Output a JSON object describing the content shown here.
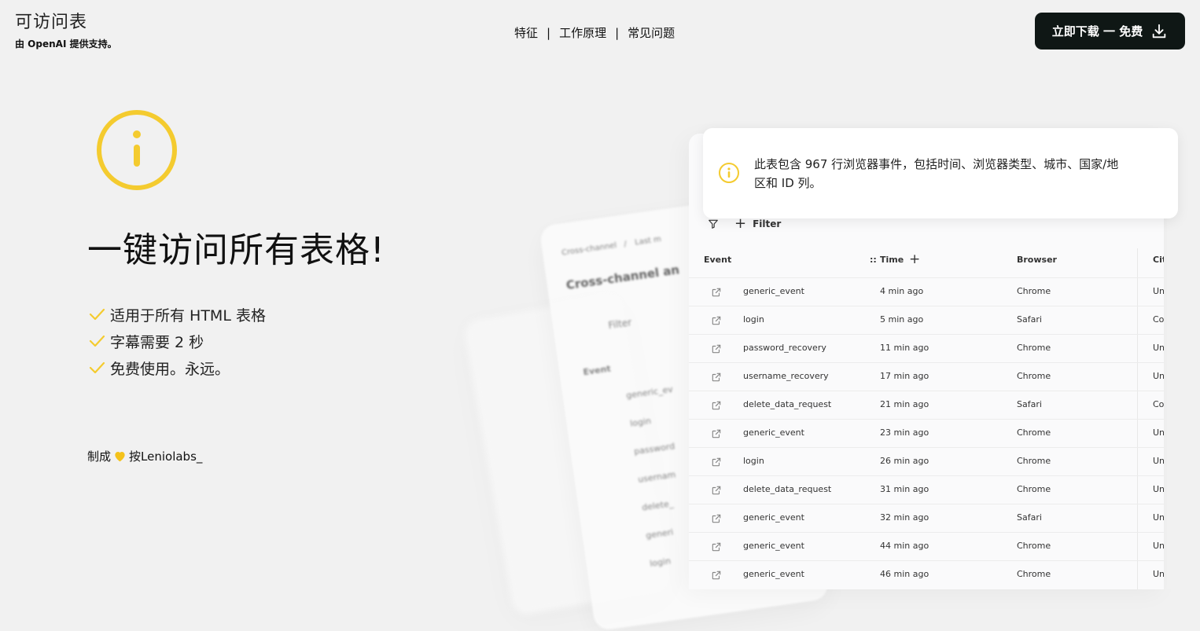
{
  "header": {
    "brand_title": "可访问表",
    "brand_sub": "由 OpenAI 提供支持。",
    "nav": [
      "特征",
      "工作原理",
      "常见问题"
    ],
    "nav_separator": "|",
    "download_label": "立即下载 一 免费"
  },
  "hero": {
    "title": "一键访问所有表格!",
    "features": [
      "适用于所有 HTML 表格",
      "字幕需要 2 秒",
      "免费使用。永远。"
    ],
    "made_prefix": "制成",
    "made_suffix": "按Leniolabs_"
  },
  "colors": {
    "accent_yellow": "#f4cb2f",
    "button_bg": "#0f1715",
    "heart": "#f4c21b"
  },
  "tooltip": {
    "text": "此表包含 967 行浏览器事件，包括时间、浏览器类型、城市、国家/地区和 ID 列。",
    "icon": "info-icon"
  },
  "back_card": {
    "breadcrumb_1": "Cross-channel",
    "breadcrumb_sep": "/",
    "breadcrumb_2": "Last m",
    "title": "Cross-channel an",
    "filter": "Filter",
    "event": "Event",
    "rows": [
      "generic_ev",
      "login",
      "password",
      "usernam",
      "delete_",
      "generi",
      "login"
    ]
  },
  "table": {
    "filter_label": "Filter",
    "time_prefix": "::",
    "columns": [
      "Event",
      "Time",
      "Browser",
      "Cit"
    ],
    "rows": [
      {
        "event": "generic_event",
        "time": "4 min ago",
        "browser": "Chrome",
        "city": "Un"
      },
      {
        "event": "login",
        "time": "5 min ago",
        "browser": "Safari",
        "city": "Co"
      },
      {
        "event": "password_recovery",
        "time": "11 min ago",
        "browser": "Chrome",
        "city": "Un"
      },
      {
        "event": "username_recovery",
        "time": "17 min ago",
        "browser": "Chrome",
        "city": "Un"
      },
      {
        "event": "delete_data_request",
        "time": "21 min ago",
        "browser": "Safari",
        "city": "Co"
      },
      {
        "event": "generic_event",
        "time": "23 min ago",
        "browser": "Chrome",
        "city": "Un"
      },
      {
        "event": "login",
        "time": "26 min ago",
        "browser": "Chrome",
        "city": "Un"
      },
      {
        "event": "delete_data_request",
        "time": "31 min ago",
        "browser": "Chrome",
        "city": "Un"
      },
      {
        "event": "generic_event",
        "time": "32 min ago",
        "browser": "Safari",
        "city": "Un"
      },
      {
        "event": "generic_event",
        "time": "44 min ago",
        "browser": "Chrome",
        "city": "Un"
      },
      {
        "event": "generic_event",
        "time": "46 min ago",
        "browser": "Chrome",
        "city": "Un"
      }
    ]
  }
}
